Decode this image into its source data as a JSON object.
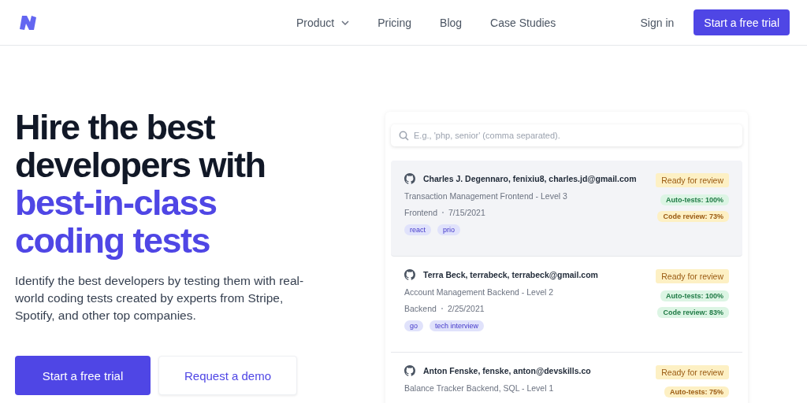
{
  "nav": {
    "items": [
      {
        "label": "Product",
        "dropdown": true
      },
      {
        "label": "Pricing",
        "dropdown": false
      },
      {
        "label": "Blog",
        "dropdown": false
      },
      {
        "label": "Case Studies",
        "dropdown": false
      }
    ],
    "sign_in": "Sign in",
    "cta": "Start a free trial"
  },
  "hero": {
    "headline": [
      {
        "text": "Hire the best",
        "accent": false
      },
      {
        "text": "developers with",
        "accent": false
      },
      {
        "text": "best-in-class",
        "accent": true
      },
      {
        "text": "coding tests",
        "accent": true
      }
    ],
    "description": "Identify the best developers by testing them with real-world coding tests created by experts from Stripe, Spotify, and other top companies.",
    "primary_button": "Start a free trial",
    "secondary_button": "Request a demo"
  },
  "panel": {
    "search": {
      "placeholder": "E.g., 'php, senior' (comma separated)."
    },
    "candidates": [
      {
        "selected": true,
        "name": "Charles J. Degennaro, fenixiu8, charles.jd@gmail.com",
        "test": "Transaction Management Frontend - Level 3",
        "track": "Frontend",
        "date": "7/15/2021",
        "tags": [
          "react",
          "prio"
        ],
        "badges": [
          {
            "text": "Ready for review",
            "color": "#fdf0c4"
          },
          {
            "text": "Auto-tests: 100%",
            "color": "#dcf5e4"
          },
          {
            "text": "Code review: 73%",
            "color": "#fdf0c4"
          }
        ]
      },
      {
        "selected": false,
        "name": "Terra Beck, terrabeck, terrabeck@gmail.com",
        "test": "Account Management Backend - Level 2",
        "track": "Backend",
        "date": "2/25/2021",
        "tags": [
          "go",
          "tech interview"
        ],
        "badges": [
          {
            "text": "Ready for review",
            "color": "#fdf0c4"
          },
          {
            "text": "Auto-tests: 100%",
            "color": "#dcf5e4"
          },
          {
            "text": "Code review: 83%",
            "color": "#dcf5e4"
          }
        ]
      },
      {
        "selected": false,
        "name": "Anton Fenske, fenske, anton@devskills.co",
        "test": "Balance Tracker Backend, SQL - Level 1",
        "badges": [
          {
            "text": "Ready for review",
            "color": "#fdf0c4"
          },
          {
            "text": "Auto-tests: 75%",
            "color": "#fdf0c4"
          }
        ]
      }
    ]
  }
}
